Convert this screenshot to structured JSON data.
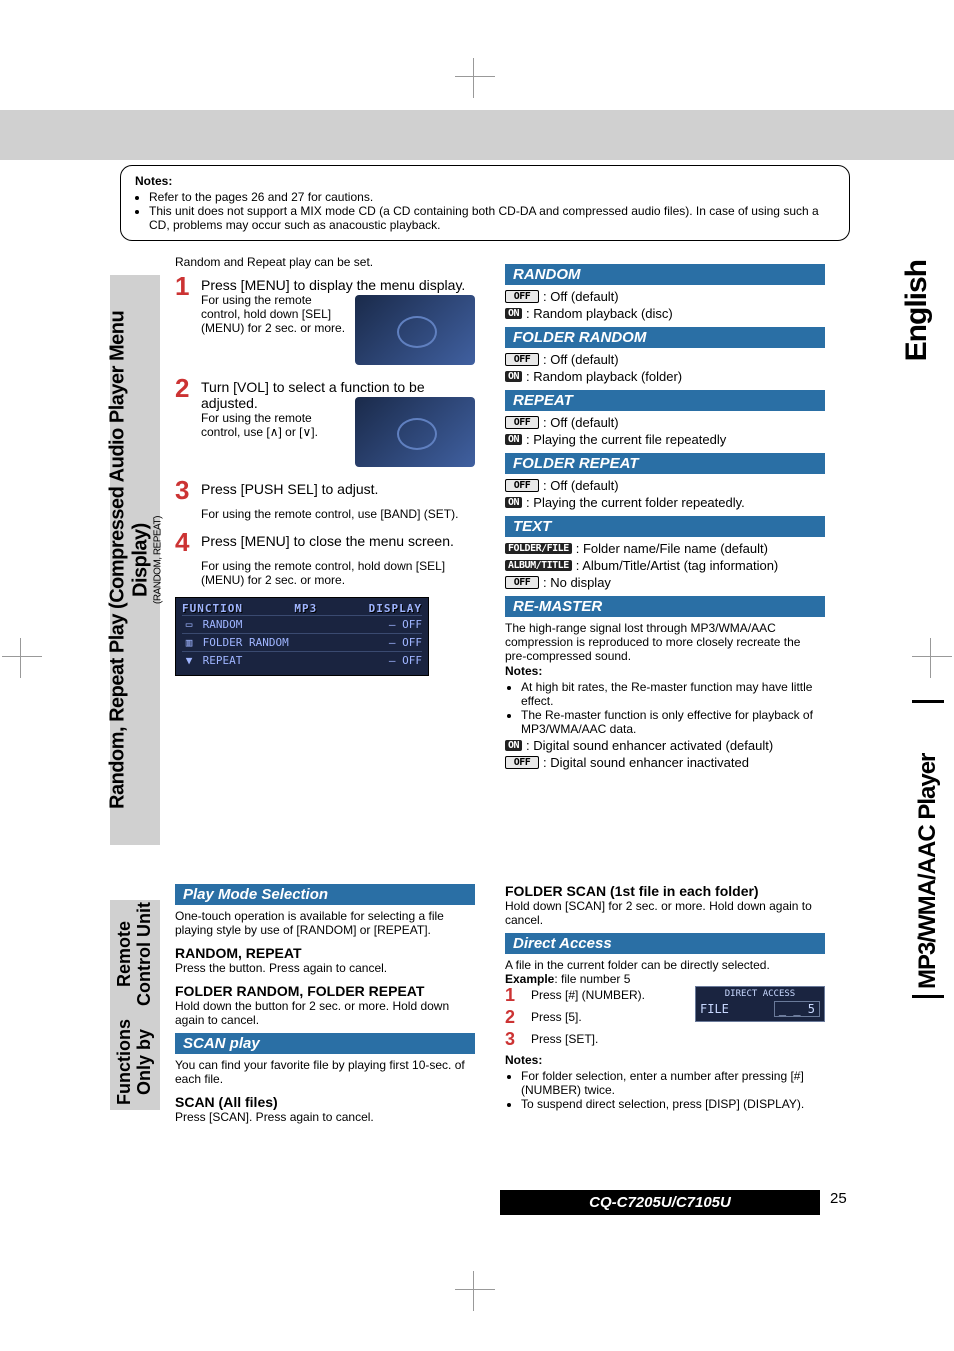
{
  "lang_tab": "English",
  "side_tab": "MP3/WMA/AAC Player",
  "sidebar1": {
    "title": "Random, Repeat Play (Compressed Audio Player Menu Display)",
    "sub": "(RANDOM, REPEAT)"
  },
  "sidebar2": {
    "line1": "Functions Only by",
    "line2": "Remote Control Unit"
  },
  "notes": {
    "heading": "Notes:",
    "items": [
      "Refer to the pages 26 and 27 for cautions.",
      "This unit does not support a MIX mode CD (a CD containing both CD-DA and compressed audio files). In case of using such a CD, problems may occur such as anacoustic playback."
    ]
  },
  "steps_intro": "Random and Repeat play can be set.",
  "steps": [
    {
      "n": "1",
      "text": "Press [MENU] to display the menu display.",
      "note": "For using the remote control, hold down [SEL] (MENU) for 2 sec. or more."
    },
    {
      "n": "2",
      "text": "Turn [VOL] to select a function to be adjusted.",
      "note": "For using the remote control, use [∧] or [∨]."
    },
    {
      "n": "3",
      "text": "Press [PUSH SEL] to adjust.",
      "note": "For using the remote control, use [BAND] (SET)."
    },
    {
      "n": "4",
      "text": "Press [MENU] to close the menu screen.",
      "note": "For using the remote control, hold down [SEL] (MENU) for 2 sec. or more."
    }
  ],
  "ftable": {
    "h1": "FUNCTION",
    "h2": "MP3",
    "h3": "DISPLAY",
    "rows": [
      {
        "icon": "▭",
        "name": "RANDOM",
        "val": "OFF"
      },
      {
        "icon": "▥",
        "name": "FOLDER RANDOM",
        "val": "OFF"
      },
      {
        "icon": "▼",
        "name": "REPEAT",
        "val": "OFF"
      }
    ]
  },
  "sections": {
    "random": {
      "title": "RANDOM",
      "off": ": Off (default)",
      "on": ": Random playback (disc)"
    },
    "frandom": {
      "title": "FOLDER RANDOM",
      "off": ": Off (default)",
      "on": ": Random playback (folder)"
    },
    "repeat": {
      "title": "REPEAT",
      "off": ": Off (default)",
      "on": ": Playing the current file repeatedly"
    },
    "frepeat": {
      "title": "FOLDER REPEAT",
      "off": ": Off (default)",
      "on": ": Playing the current folder repeatedly."
    },
    "text": {
      "title": "TEXT",
      "r1": {
        "chip": "FOLDER/FILE",
        "desc": ": Folder name/File name (default)"
      },
      "r2": {
        "chip": "ALBUM/TITLE",
        "desc": ": Album/Title/Artist (tag information)"
      },
      "r3": {
        "chip": "OFF",
        "desc": ": No display"
      }
    },
    "remaster": {
      "title": "RE-MASTER",
      "body": "The high-range signal lost through MP3/WMA/AAC compression is reproduced to more closely recreate the pre-compressed sound.",
      "notes_h": "Notes:",
      "notes": [
        "At high bit rates, the Re-master function may have little effect.",
        "The Re-master function is only effective for playback of MP3/WMA/AAC data."
      ],
      "on": ": Digital sound enhancer activated (default)",
      "off": ": Digital sound enhancer inactivated"
    }
  },
  "pms": {
    "title": "Play Mode Selection",
    "body": "One-touch operation is available for selecting a file playing style by use of [RANDOM] or [REPEAT].",
    "h1": "RANDOM, REPEAT",
    "b1": "Press the button. Press again to cancel.",
    "h2": "FOLDER RANDOM, FOLDER REPEAT",
    "b2": "Hold down the button for 2 sec. or more. Hold down again to cancel."
  },
  "scan": {
    "title": "SCAN play",
    "body": "You can find your favorite file by playing first 10-sec. of each file.",
    "h1": "SCAN (All files)",
    "b1": "Press [SCAN]. Press again to cancel."
  },
  "fscan": {
    "title": "FOLDER SCAN (1st file in each folder)",
    "body": "Hold down [SCAN] for 2 sec. or more. Hold down again to cancel."
  },
  "da": {
    "title": "Direct Access",
    "body": "A file in the current folder can be directly selected.",
    "example_h": "Example",
    "example_t": ": file number 5",
    "steps": [
      {
        "n": "1",
        "t": "Press [#] (NUMBER)."
      },
      {
        "n": "2",
        "t": "Press [5]."
      },
      {
        "n": "3",
        "t": "Press [SET]."
      }
    ],
    "notes_h": "Notes:",
    "notes": [
      "For folder selection, enter a number after pressing [#] (NUMBER) twice.",
      "To suspend direct selection, press [DISP] (DISPLAY)."
    ],
    "box_head": "DIRECT ACCESS",
    "box_label": "FILE",
    "box_val": "_ _ 5"
  },
  "chips": {
    "off": "OFF",
    "on": "ON"
  },
  "footer": {
    "model": "CQ-C7205U/C7105U",
    "page": "25"
  }
}
